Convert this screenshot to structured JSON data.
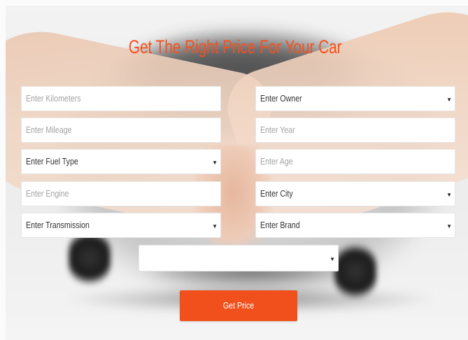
{
  "title": "Get The Right Price For Your Car",
  "accent_color": "#f4511e",
  "form": {
    "kilometers": {
      "placeholder": "Enter Kilometers"
    },
    "owner": {
      "selected": "Enter Owner"
    },
    "mileage": {
      "placeholder": "Enter Mileage"
    },
    "year": {
      "placeholder": "Enter Year"
    },
    "fuel_type": {
      "selected": "Enter Fuel Type"
    },
    "age": {
      "placeholder": "Enter Age"
    },
    "engine": {
      "placeholder": "Enter Engine"
    },
    "city": {
      "selected": "Enter City"
    },
    "transmission": {
      "selected": "Enter Transmission"
    },
    "brand": {
      "selected": "Enter Brand"
    },
    "model": {
      "selected": ""
    }
  },
  "submit_label": "Get Price",
  "icons": {
    "dropdown": "caret-down-icon"
  }
}
